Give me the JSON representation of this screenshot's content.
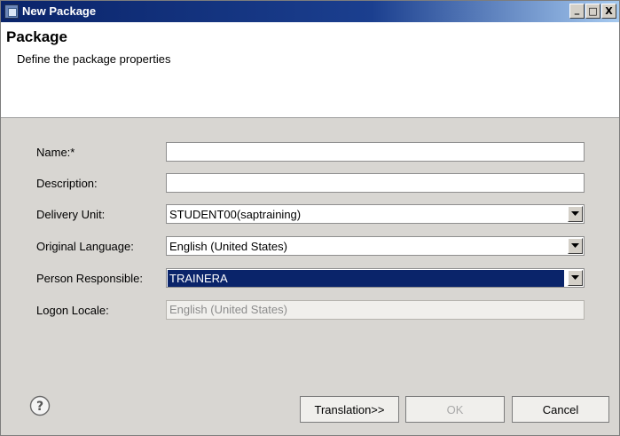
{
  "window": {
    "title": "New Package",
    "controls": {
      "minimize": "_",
      "maximize": "□",
      "close": "X"
    }
  },
  "header": {
    "title": "Package",
    "description": "Define the package properties"
  },
  "form": {
    "name": {
      "label": "Name:*",
      "value": ""
    },
    "description": {
      "label": "Description:",
      "value": ""
    },
    "delivery_unit": {
      "label": "Delivery Unit:",
      "value": "STUDENT00(saptraining)"
    },
    "original_language": {
      "label": "Original Language:",
      "value": "English (United States)"
    },
    "person_responsible": {
      "label": "Person Responsible:",
      "value": "TRAINERA"
    },
    "logon_locale": {
      "label": "Logon Locale:",
      "value": "English (United States)"
    }
  },
  "buttons": {
    "translation": "Translation>>",
    "ok": "OK",
    "cancel": "Cancel"
  },
  "icons": {
    "help": "help-icon",
    "dropdown": "chevron-down-icon"
  },
  "colors": {
    "titlebar": "#0a246a",
    "selection": "#0a246a",
    "dialog_bg": "#d8d6d2"
  }
}
